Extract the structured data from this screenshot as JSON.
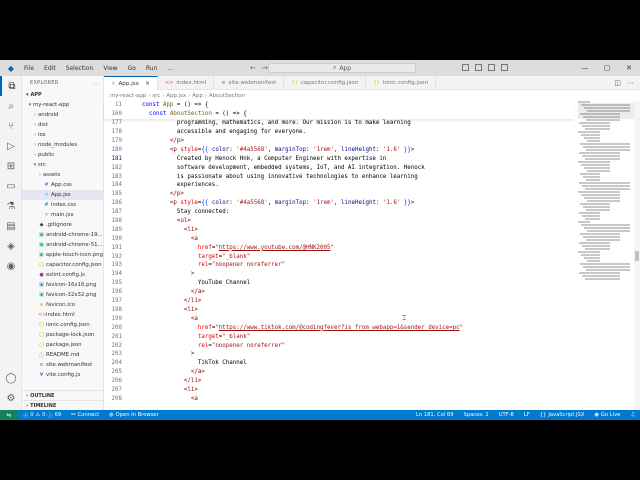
{
  "titlebar": {
    "menu": [
      "File",
      "Edit",
      "Selection",
      "View",
      "Go",
      "Run",
      "..."
    ],
    "search_text": "App",
    "window_controls": [
      "—",
      "▢",
      "✕"
    ]
  },
  "sidebar": {
    "title": "EXPLORER",
    "title_menu": "...",
    "root_label": "APP",
    "items": [
      {
        "label": "my-react-app",
        "indent": 1,
        "chev": "▾",
        "icon": "",
        "color": "#333333",
        "selected": false
      },
      {
        "label": "android",
        "indent": 2,
        "chev": "›",
        "icon": "",
        "color": "#333333",
        "selected": false
      },
      {
        "label": "dist",
        "indent": 2,
        "chev": "›",
        "icon": "",
        "color": "#333333",
        "selected": false
      },
      {
        "label": "ios",
        "indent": 2,
        "chev": "›",
        "icon": "",
        "color": "#333333",
        "selected": false
      },
      {
        "label": "node_modules",
        "indent": 2,
        "chev": "›",
        "icon": "",
        "color": "#333333",
        "selected": false
      },
      {
        "label": "public",
        "indent": 2,
        "chev": "›",
        "icon": "",
        "color": "#333333",
        "selected": false
      },
      {
        "label": "src",
        "indent": 2,
        "chev": "▾",
        "icon": "",
        "color": "#333333",
        "selected": false
      },
      {
        "label": "assets",
        "indent": 3,
        "chev": "›",
        "icon": "",
        "color": "#333333",
        "selected": false
      },
      {
        "label": "App.css",
        "indent": 3,
        "chev": "",
        "icon": "#",
        "color": "#1e7ed6",
        "selected": false
      },
      {
        "label": "App.jsx",
        "indent": 3,
        "chev": "",
        "icon": "⚛",
        "color": "#1e9ed6",
        "selected": true
      },
      {
        "label": "index.css",
        "indent": 3,
        "chev": "",
        "icon": "#",
        "color": "#1e7ed6",
        "selected": false
      },
      {
        "label": "main.jsx",
        "indent": 3,
        "chev": "",
        "icon": "⚛",
        "color": "#1e9ed6",
        "selected": false
      },
      {
        "label": ".gitignore",
        "indent": 2,
        "chev": "",
        "icon": "◆",
        "color": "#444444",
        "selected": false
      },
      {
        "label": "android-chrome-19...",
        "indent": 2,
        "chev": "",
        "icon": "▣",
        "color": "#26a69a",
        "selected": false
      },
      {
        "label": "android-chrome-51...",
        "indent": 2,
        "chev": "",
        "icon": "▣",
        "color": "#26a69a",
        "selected": false
      },
      {
        "label": "apple-touch-icon.png",
        "indent": 2,
        "chev": "",
        "icon": "▣",
        "color": "#26a69a",
        "selected": false
      },
      {
        "label": "capacitor.config.json",
        "indent": 2,
        "chev": "",
        "icon": "{}",
        "color": "#cbcb41",
        "selected": false
      },
      {
        "label": "eslint.config.js",
        "indent": 2,
        "chev": "",
        "icon": "●",
        "color": "#8e44ad",
        "selected": false
      },
      {
        "label": "favicon-16x16.png",
        "indent": 2,
        "chev": "",
        "icon": "▣",
        "color": "#26a69a",
        "selected": false
      },
      {
        "label": "favicon-32x32.png",
        "indent": 2,
        "chev": "",
        "icon": "▣",
        "color": "#26a69a",
        "selected": false
      },
      {
        "label": "favicon.ico",
        "indent": 2,
        "chev": "",
        "icon": "★",
        "color": "#e6b800",
        "selected": false
      },
      {
        "label": "index.html",
        "indent": 2,
        "chev": "",
        "icon": "<>",
        "color": "#e44d26",
        "selected": false
      },
      {
        "label": "ionic.config.json",
        "indent": 2,
        "chev": "",
        "icon": "{}",
        "color": "#cbcb41",
        "selected": false
      },
      {
        "label": "package-lock.json",
        "indent": 2,
        "chev": "",
        "icon": "{}",
        "color": "#cbcb41",
        "selected": false
      },
      {
        "label": "package.json",
        "indent": 2,
        "chev": "",
        "icon": "{}",
        "color": "#cbcb41",
        "selected": false
      },
      {
        "label": "README.md",
        "indent": 2,
        "chev": "",
        "icon": "ⓘ",
        "color": "#519aba",
        "selected": false
      },
      {
        "label": "site.webmanifest",
        "indent": 2,
        "chev": "",
        "icon": "≡",
        "color": "#777777",
        "selected": false
      },
      {
        "label": "vite.config.js",
        "indent": 2,
        "chev": "",
        "icon": "▼",
        "color": "#a06bff",
        "selected": false
      }
    ],
    "outline_label": "OUTLINE",
    "timeline_label": "TIMELINE"
  },
  "tabs": [
    {
      "label": "App.jsx",
      "icon": "⚛",
      "color": "#1e9ed6",
      "active": true
    },
    {
      "label": "index.html",
      "icon": "<>",
      "color": "#e44d26",
      "active": false
    },
    {
      "label": "site.webmanifest",
      "icon": "≡",
      "color": "#777777",
      "active": false
    },
    {
      "label": "capacitor.config.json",
      "icon": "{}",
      "color": "#cbcb41",
      "active": false
    },
    {
      "label": "ionic.config.json",
      "icon": "{}",
      "color": "#cbcb41",
      "active": false
    }
  ],
  "tab_close": "×",
  "breadcrumb": [
    "my-react-app",
    "src",
    "App.jsx",
    "App",
    "AboutSection"
  ],
  "sticky_lines": [
    {
      "n": "11",
      "tokens": [
        [
          "kw",
          "const "
        ],
        [
          "fn",
          "App"
        ],
        [
          "txt",
          " = () => {"
        ]
      ]
    },
    {
      "n": "160",
      "tokens": [
        [
          "txt",
          "  "
        ],
        [
          "kw",
          "const "
        ],
        [
          "fn",
          "AboutSection"
        ],
        [
          "txt",
          " = () => {"
        ]
      ]
    }
  ],
  "code_lines": [
    {
      "n": "177",
      "tokens": [
        [
          "txt",
          "          programming, mathematics, and more. Our mission is to make learning"
        ]
      ]
    },
    {
      "n": "178",
      "tokens": [
        [
          "txt",
          "          accessible and engaging for everyone."
        ]
      ]
    },
    {
      "n": "179",
      "tokens": [
        [
          "txt",
          "        "
        ],
        [
          "tag",
          "</p>"
        ]
      ]
    },
    {
      "n": "180",
      "tokens": [
        [
          "txt",
          "        "
        ],
        [
          "tag",
          "<p"
        ],
        [
          "attr",
          " style"
        ],
        [
          "txt",
          "="
        ],
        [
          "br",
          "{{"
        ],
        [
          "var",
          " color"
        ],
        [
          "txt",
          ": "
        ],
        [
          "str",
          "'#4a5568'"
        ],
        [
          "txt",
          ", "
        ],
        [
          "var",
          "marginTop"
        ],
        [
          "txt",
          ": "
        ],
        [
          "str",
          "'1rem'"
        ],
        [
          "txt",
          ", "
        ],
        [
          "var",
          "lineHeight"
        ],
        [
          "txt",
          ": "
        ],
        [
          "str",
          "'1.6'"
        ],
        [
          "br",
          " }}"
        ],
        [
          "tag",
          ">"
        ]
      ]
    },
    {
      "n": "181",
      "tokens": [
        [
          "txt",
          "          Created by Henock Hnk, a Computer Engineer with expertise in"
        ]
      ]
    },
    {
      "n": "182",
      "tokens": [
        [
          "txt",
          "          software development, embedded systems, IoT, and AI integration. Henock"
        ]
      ]
    },
    {
      "n": "183",
      "tokens": [
        [
          "txt",
          "          is passionate about using innovative technologies to enhance learning"
        ]
      ]
    },
    {
      "n": "184",
      "tokens": [
        [
          "txt",
          "          experiences."
        ]
      ]
    },
    {
      "n": "185",
      "tokens": [
        [
          "txt",
          "        "
        ],
        [
          "tag",
          "</p>"
        ]
      ]
    },
    {
      "n": "186",
      "tokens": [
        [
          "txt",
          "        "
        ],
        [
          "tag",
          "<p"
        ],
        [
          "attr",
          " style"
        ],
        [
          "txt",
          "="
        ],
        [
          "br",
          "{{"
        ],
        [
          "var",
          " color"
        ],
        [
          "txt",
          ": "
        ],
        [
          "str",
          "'#4a5568'"
        ],
        [
          "txt",
          ", "
        ],
        [
          "var",
          "marginTop"
        ],
        [
          "txt",
          ": "
        ],
        [
          "str",
          "'1rem'"
        ],
        [
          "txt",
          ", "
        ],
        [
          "var",
          "lineHeight"
        ],
        [
          "txt",
          ": "
        ],
        [
          "str",
          "'1.6'"
        ],
        [
          "br",
          " }}"
        ],
        [
          "tag",
          ">"
        ]
      ]
    },
    {
      "n": "187",
      "tokens": [
        [
          "txt",
          "          Stay connected:"
        ]
      ]
    },
    {
      "n": "188",
      "tokens": [
        [
          "txt",
          "          "
        ],
        [
          "tag",
          "<ul>"
        ]
      ]
    },
    {
      "n": "189",
      "tokens": [
        [
          "txt",
          "            "
        ],
        [
          "tag",
          "<li>"
        ]
      ]
    },
    {
      "n": "190",
      "tokens": [
        [
          "txt",
          "              "
        ],
        [
          "tag",
          "<a"
        ]
      ]
    },
    {
      "n": "191",
      "tokens": [
        [
          "txt",
          "                "
        ],
        [
          "attr",
          "href"
        ],
        [
          "txt",
          "="
        ],
        [
          "str",
          "\""
        ],
        [
          "link",
          "https://www.youtube.com/@HNK2005"
        ],
        [
          "str",
          "\""
        ]
      ]
    },
    {
      "n": "192",
      "tokens": [
        [
          "txt",
          "                "
        ],
        [
          "attr",
          "target"
        ],
        [
          "txt",
          "="
        ],
        [
          "str",
          "\"_blank\""
        ]
      ]
    },
    {
      "n": "193",
      "tokens": [
        [
          "txt",
          "                "
        ],
        [
          "attr",
          "rel"
        ],
        [
          "txt",
          "="
        ],
        [
          "str",
          "\"noopener noreferrer\""
        ]
      ]
    },
    {
      "n": "194",
      "tokens": [
        [
          "txt",
          "              "
        ],
        [
          "tag",
          ">"
        ]
      ]
    },
    {
      "n": "195",
      "tokens": [
        [
          "txt",
          "                YouTube Channel"
        ]
      ]
    },
    {
      "n": "196",
      "tokens": [
        [
          "txt",
          "              "
        ],
        [
          "tag",
          "</a>"
        ]
      ]
    },
    {
      "n": "197",
      "tokens": [
        [
          "txt",
          "            "
        ],
        [
          "tag",
          "</li>"
        ]
      ]
    },
    {
      "n": "198",
      "tokens": [
        [
          "txt",
          "            "
        ],
        [
          "tag",
          "<li>"
        ]
      ]
    },
    {
      "n": "199",
      "tokens": [
        [
          "txt",
          "              "
        ],
        [
          "tag",
          "<a"
        ]
      ]
    },
    {
      "n": "200",
      "tokens": [
        [
          "txt",
          "                "
        ],
        [
          "attr",
          "href"
        ],
        [
          "txt",
          "="
        ],
        [
          "str",
          "\""
        ],
        [
          "link",
          "https://www.tiktok.com/@codingfever?is_from_webapp=1&sender_device=pc"
        ],
        [
          "str",
          "\""
        ]
      ]
    },
    {
      "n": "201",
      "tokens": [
        [
          "txt",
          "                "
        ],
        [
          "attr",
          "target"
        ],
        [
          "txt",
          "="
        ],
        [
          "str",
          "\"_blank\""
        ]
      ]
    },
    {
      "n": "202",
      "tokens": [
        [
          "txt",
          "                "
        ],
        [
          "attr",
          "rel"
        ],
        [
          "txt",
          "="
        ],
        [
          "str",
          "\"noopener noreferrer\""
        ]
      ]
    },
    {
      "n": "203",
      "tokens": [
        [
          "txt",
          "              "
        ],
        [
          "tag",
          ">"
        ]
      ]
    },
    {
      "n": "204",
      "tokens": [
        [
          "txt",
          "                TikTok Channel"
        ]
      ]
    },
    {
      "n": "205",
      "tokens": [
        [
          "txt",
          "              "
        ],
        [
          "tag",
          "</a>"
        ]
      ]
    },
    {
      "n": "206",
      "tokens": [
        [
          "txt",
          "            "
        ],
        [
          "tag",
          "</li>"
        ]
      ]
    },
    {
      "n": "207",
      "tokens": [
        [
          "txt",
          "            "
        ],
        [
          "tag",
          "<li>"
        ]
      ]
    },
    {
      "n": "208",
      "tokens": [
        [
          "txt",
          "              "
        ],
        [
          "tag",
          "<a"
        ]
      ]
    }
  ],
  "current_line": "181",
  "statusbar": {
    "errors": "0",
    "warnings": "0",
    "info": "69",
    "connect": "Connect",
    "open_browser": "Open In Browser",
    "position": "Ln 181, Col 69",
    "spaces": "Spaces: 2",
    "encoding": "UTF-8",
    "eol": "LF",
    "language": "JavaScript JSX",
    "golive": "Go Live"
  },
  "colors": {
    "statusbar": "#007acc",
    "remote": "#16825d",
    "accent": "#0066b8"
  }
}
